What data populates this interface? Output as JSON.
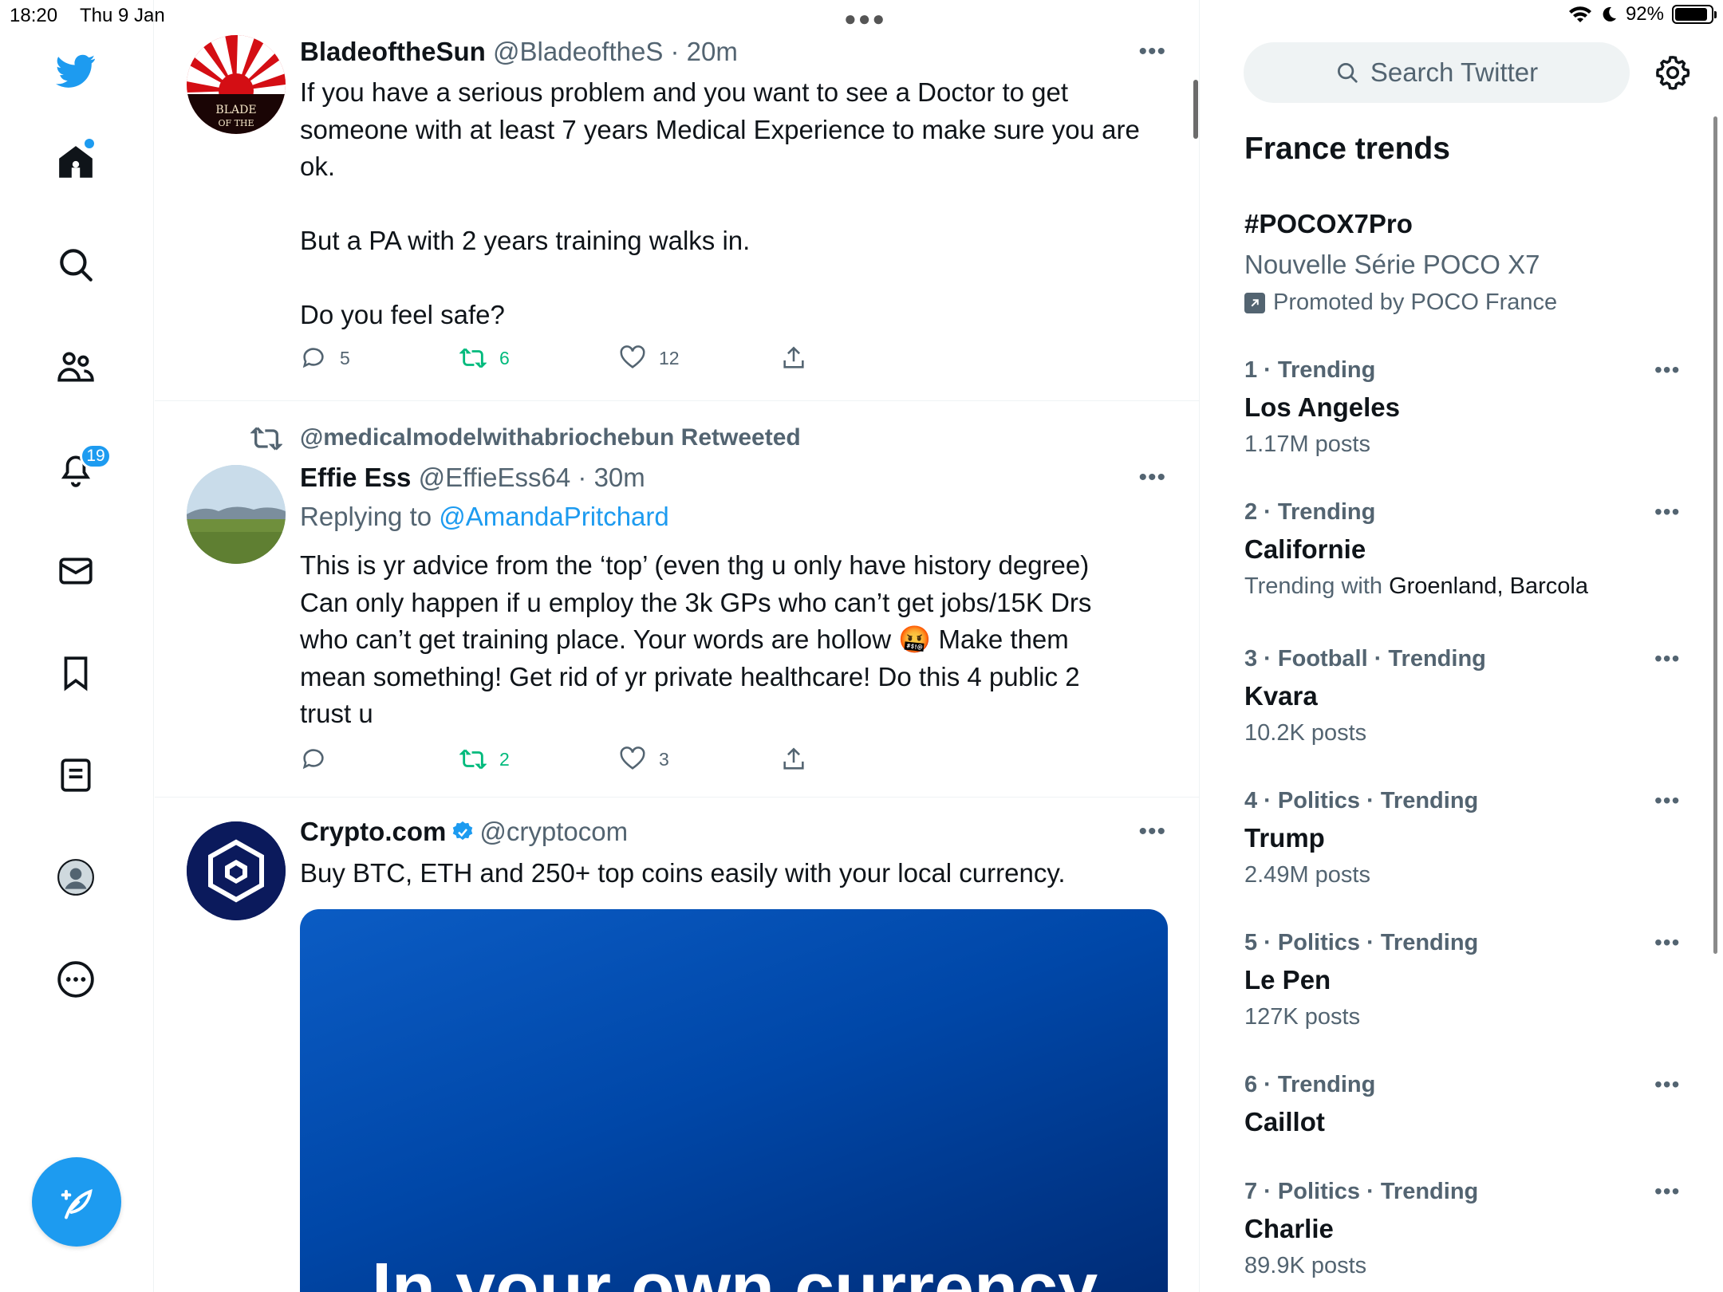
{
  "status_bar": {
    "time": "18:20",
    "date": "Thu 9 Jan",
    "battery": "92%",
    "battery_level": 0.92
  },
  "nav": {
    "notification_count": "19"
  },
  "tweets": [
    {
      "name": "BladeoftheSun",
      "handle": "@BladeoftheS",
      "time": "· 20m",
      "text": "If you have a serious problem and you want to see a Doctor to get\nsomeone with at least 7 years Medical Experience to make sure you are\nok.\n\nBut a PA with 2 years training walks in.\n\nDo you feel safe?",
      "replies": "5",
      "retweets": "6",
      "likes": "12"
    },
    {
      "retweeted_by": "@medicalmodelwithabriochebun Retweeted",
      "name": "Effie Ess",
      "handle": "@EffieEss64",
      "time": "· 30m",
      "replying_label": "Replying to",
      "replying_to": "@AmandaPritchard",
      "text": "This is yr advice from the ‘top’ (even thg u only have history degree)\nCan only happen if u employ the 3k GPs who can’t get jobs/15K Drs\nwho can’t get training place. Your words are hollow 🤬 Make them\nmean something! Get rid of yr private healthcare! Do this 4 public 2\ntrust u",
      "replies": "",
      "retweets": "2",
      "likes": "3"
    },
    {
      "name": "Crypto.com",
      "handle": "@cryptocom",
      "text": "Buy BTC, ETH and 250+ top coins easily with your local currency.",
      "media_text": "In your own currency"
    }
  ],
  "sidebar": {
    "search_placeholder": "Search Twitter",
    "trends_title": "France trends",
    "promoted": {
      "tag": "#POCOX7Pro",
      "desc": "Nouvelle Série POCO X7",
      "by": "Promoted by POCO France"
    },
    "trends": [
      {
        "meta": "1 · Trending",
        "name": "Los Angeles",
        "sub": "1.17M posts"
      },
      {
        "meta": "2 · Trending",
        "name": "Californie",
        "sub_label": "Trending with",
        "sub_values": "Groenland, Barcola"
      },
      {
        "meta": "3 · Football · Trending",
        "name": "Kvara",
        "sub": "10.2K posts"
      },
      {
        "meta": "4 · Politics · Trending",
        "name": "Trump",
        "sub": "2.49M posts"
      },
      {
        "meta": "5 · Politics · Trending",
        "name": "Le Pen",
        "sub": "127K posts"
      },
      {
        "meta": "6 · Trending",
        "name": "Caillot",
        "sub": ""
      },
      {
        "meta": "7 · Politics · Trending",
        "name": "Charlie",
        "sub": "89.9K posts"
      }
    ]
  },
  "colors": {
    "accent": "#1d9bf0",
    "retweet": "#00ba7c",
    "secondary_text": "#536471",
    "crypto_brand": "#0b1a5c"
  }
}
